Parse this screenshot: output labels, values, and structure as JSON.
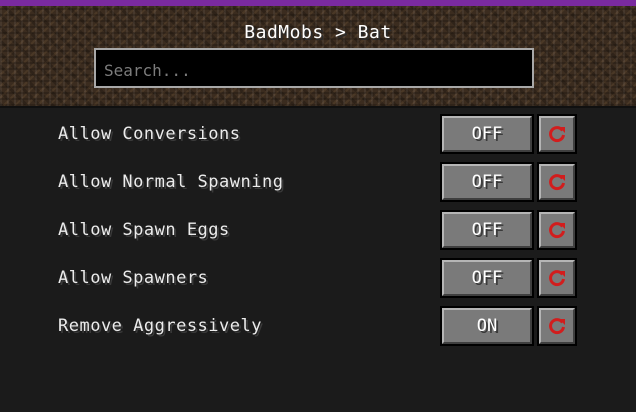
{
  "header": {
    "title": "BadMobs > Bat",
    "search_placeholder": "Search..."
  },
  "colors": {
    "top_accent": "#7a2aa0",
    "reset_icon": "#d21d1d"
  },
  "settings": [
    {
      "label": "Allow Conversions",
      "value": "OFF",
      "reset_icon": "reset-icon"
    },
    {
      "label": "Allow Normal Spawning",
      "value": "OFF",
      "reset_icon": "reset-icon"
    },
    {
      "label": "Allow Spawn Eggs",
      "value": "OFF",
      "reset_icon": "reset-icon"
    },
    {
      "label": "Allow Spawners",
      "value": "OFF",
      "reset_icon": "reset-icon"
    },
    {
      "label": "Remove Aggressively",
      "value": "ON",
      "reset_icon": "reset-icon"
    }
  ]
}
